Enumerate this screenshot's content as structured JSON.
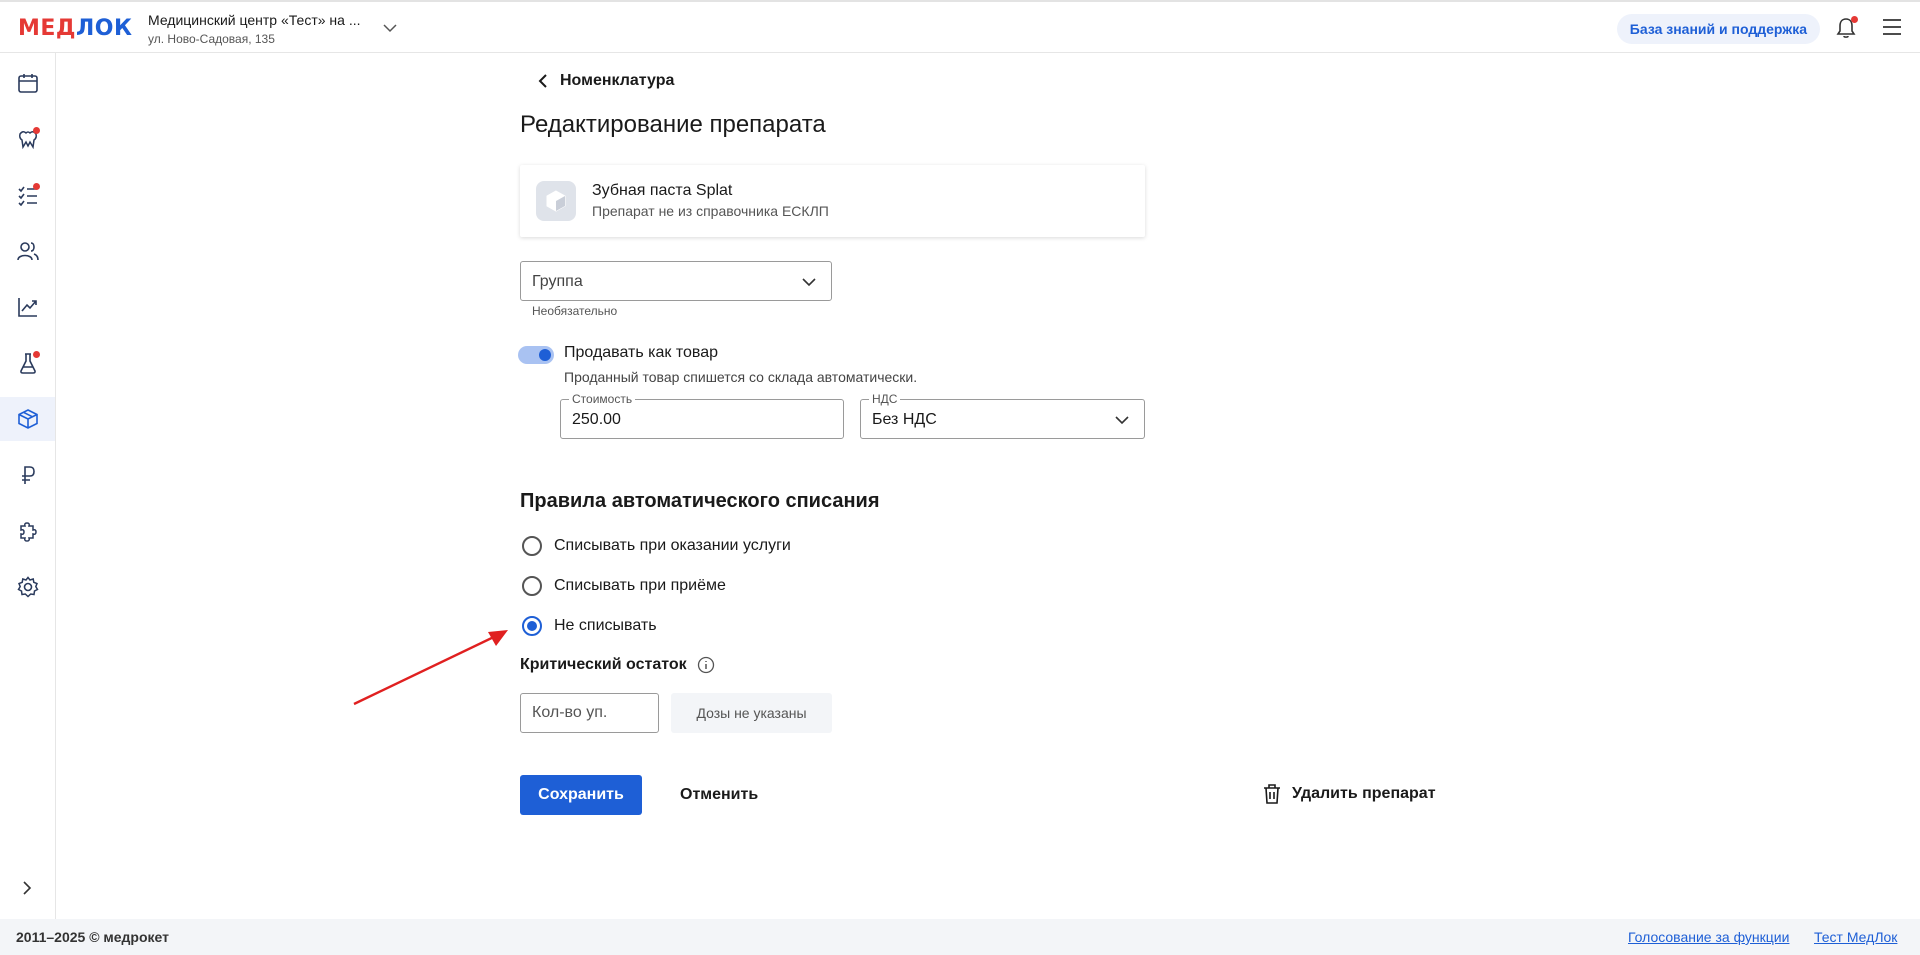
{
  "app": {
    "logo": {
      "part1": "МЕД",
      "part2": "ЛОК"
    },
    "clinic": {
      "name": "Медицинский центр «Тест» на ...",
      "address": "ул. Ново-Садовая, 135"
    },
    "knowledge_base_label": "База знаний и поддержка"
  },
  "sidebar": {
    "items": [
      {
        "icon": "calendar-icon",
        "badge": false
      },
      {
        "icon": "teeth-icon",
        "badge": true
      },
      {
        "icon": "checklist-icon",
        "badge": true
      },
      {
        "icon": "users-icon",
        "badge": false
      },
      {
        "icon": "chart-icon",
        "badge": false
      },
      {
        "icon": "flask-icon",
        "badge": true
      },
      {
        "icon": "box-icon",
        "badge": false,
        "active": true
      },
      {
        "icon": "ruble-icon",
        "badge": false
      },
      {
        "icon": "puzzle-icon",
        "badge": false
      },
      {
        "icon": "gear-icon",
        "badge": false
      }
    ]
  },
  "main": {
    "back_label": "Номенклатура",
    "title": "Редактирование препарата",
    "product": {
      "name": "Зубная паста Splat",
      "subtitle": "Препарат не из справочника ЕСКЛП"
    },
    "group": {
      "value": "Группа",
      "hint": "Необязательно"
    },
    "sell": {
      "label": "Продавать как товар",
      "hint": "Проданный товар спишется со склада автоматически.",
      "enabled": true
    },
    "cost": {
      "label": "Стоимость",
      "value": "250.00"
    },
    "vat": {
      "label": "НДС",
      "value": "Без НДС"
    },
    "rules": {
      "title": "Правила автоматического списания",
      "options": [
        {
          "label": "Списывать при оказании услуги",
          "checked": false
        },
        {
          "label": "Списывать при приёме",
          "checked": false
        },
        {
          "label": "Не списывать",
          "checked": true
        }
      ]
    },
    "critical": {
      "title": "Критический остаток",
      "placeholder": "Кол-во уп.",
      "doses_label": "Дозы не указаны"
    },
    "actions": {
      "save": "Сохранить",
      "cancel": "Отменить",
      "delete": "Удалить препарат"
    }
  },
  "footer": {
    "copyright": "2011–2025 © медрокет",
    "links": [
      "Голосование за функции",
      "Тест МедЛок"
    ]
  },
  "colors": {
    "accent": "#1e5fd6",
    "brand_red": "#e53935"
  }
}
